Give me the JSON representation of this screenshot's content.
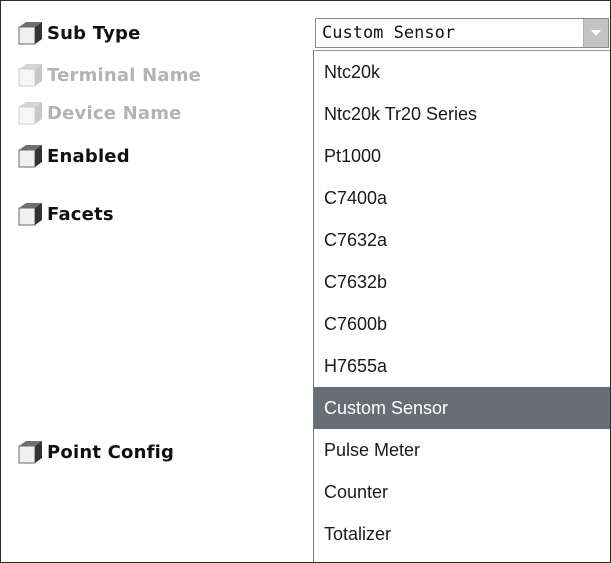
{
  "properties": [
    {
      "id": "sub-type",
      "label": "Sub Type",
      "disabled": false
    },
    {
      "id": "terminal-name",
      "label": "Terminal Name",
      "disabled": true
    },
    {
      "id": "device-name",
      "label": "Device Name",
      "disabled": true
    },
    {
      "id": "enabled",
      "label": "Enabled",
      "disabled": false
    },
    {
      "id": "facets",
      "label": "Facets",
      "disabled": false
    },
    {
      "id": "point-config",
      "label": "Point Config",
      "disabled": false
    }
  ],
  "sub_type_select": {
    "value": "Custom Sensor",
    "options": [
      "Ntc20k",
      "Ntc20k Tr20 Series",
      "Pt1000",
      "C7400a",
      "C7632a",
      "C7632b",
      "C7600b",
      "H7655a",
      "Custom Sensor",
      "Pulse Meter",
      "Counter",
      "Totalizer"
    ],
    "selected_option": "Custom Sensor"
  },
  "icons": {
    "property": "cube-icon",
    "dropdown": "chevron-down-icon"
  },
  "colors": {
    "highlight": "#666d75",
    "cube_dark": "#333333",
    "cube_light": "#f0f0f0",
    "disabled_text": "#b3b3b3"
  }
}
